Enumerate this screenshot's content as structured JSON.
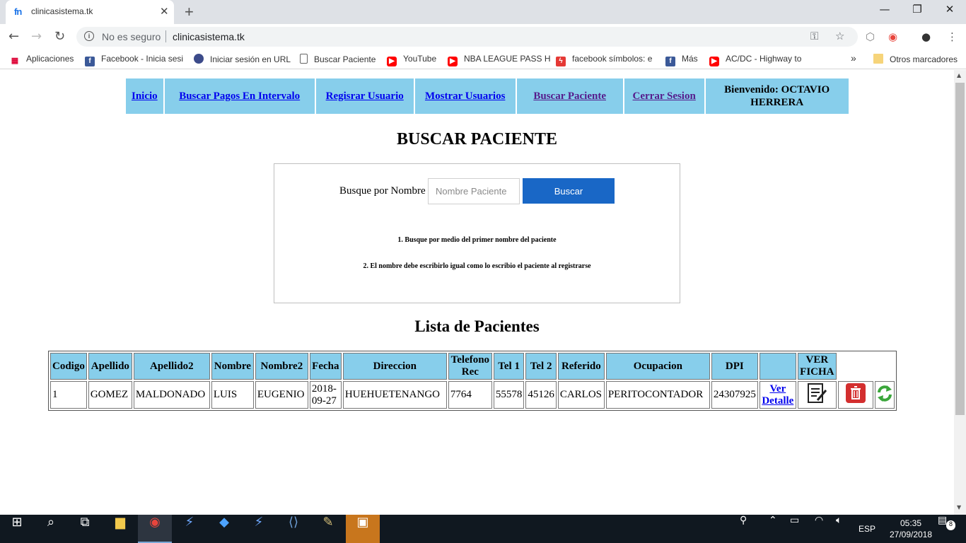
{
  "browser": {
    "tab_title": "clinicasistema.tk",
    "tab_favicon": "fn",
    "security_label": "No es seguro",
    "url": "clinicasistema.tk"
  },
  "bookmarks": {
    "apps": "Aplicaciones",
    "items": [
      "Facebook - Inicia sesi",
      "Iniciar sesión en URL",
      "Buscar Paciente",
      "YouTube",
      "NBA LEAGUE PASS H",
      "facebook símbolos: e",
      "Más",
      "AC/DC - Highway to"
    ],
    "more": "»",
    "other": "Otros marcadores"
  },
  "menu": {
    "items": [
      "Inicio",
      "Buscar Pagos En Intervalo",
      "Regisrar Usuario",
      "Mostrar Usuarios",
      "Buscar Paciente",
      "Cerrar Sesion"
    ],
    "welcome": "Bienvenido: OCTAVIO HERRERA"
  },
  "page_title": "BUSCAR PACIENTE",
  "search": {
    "label": "Busque por Nombre",
    "placeholder": "Nombre Paciente",
    "button": "Buscar",
    "hint1": "1. Busque por medio del primer nombre del paciente",
    "hint2": "2. El nombre debe escribirlo igual como lo escribio el paciente al registrarse"
  },
  "list_title": "Lista de Pacientes",
  "table": {
    "headers": [
      "Codigo",
      "Apellido",
      "Apellido2",
      "Nombre",
      "Nombre2",
      "Fecha",
      "Direccion",
      "Telefono Rec",
      "Tel 1",
      "Tel 2",
      "Referido",
      "Ocupacion",
      "DPI",
      "",
      "VER FICHA"
    ],
    "rows": [
      {
        "codigo": "1",
        "apellido": "GOMEZ",
        "apellido2": "MALDONADO",
        "nombre": "LUIS",
        "nombre2": "EUGENIO",
        "fecha": "2018-09-27",
        "direccion": "HUEHUETENANGO",
        "telefono_rec": "7764",
        "tel1": "55578",
        "tel2": "45126",
        "referido": "CARLOS",
        "ocupacion": "PERITOCONTADOR",
        "dpi": "24307925",
        "detalle": "Ver Detalle"
      }
    ]
  },
  "taskbar": {
    "language": "ESP",
    "time": "05:35",
    "date": "27/09/2018",
    "notifications": "8"
  },
  "colors": {
    "menu_bg": "#87ceeb",
    "button_blue": "#1967c6",
    "link": "#0000ee",
    "link_visited": "#551a8b"
  }
}
